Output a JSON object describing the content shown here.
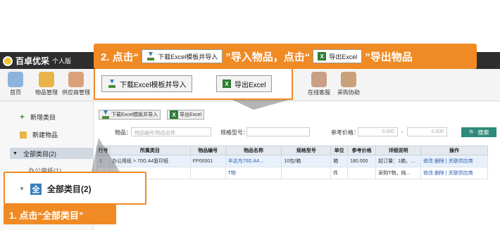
{
  "app": {
    "logo": "百卓优采",
    "edition": "个人版"
  },
  "toolbar": {
    "items": [
      {
        "label": "首页",
        "icon": "home-icon"
      },
      {
        "label": "物品管理",
        "icon": "box-icon"
      },
      {
        "label": "供应商管理",
        "icon": "supplier-icon"
      },
      {
        "label": "在线客服",
        "icon": "service-icon"
      },
      {
        "label": "采购协助",
        "icon": "assist-icon"
      }
    ]
  },
  "sidebar": {
    "add_category": "新增类目",
    "new_item": "新建物品",
    "all_categories": "全部类目(2)",
    "sub_category": "办公用纸(1)"
  },
  "main": {
    "download_template": "下载Excel模板并导入",
    "export_excel": "导出Excel",
    "filter": {
      "item_label": "物品：",
      "item_placeholder": "物品编号/物品名称",
      "spec_label": "规格型号：",
      "price_label": "参考价格：",
      "price_min": "0.000",
      "price_max": "0.000",
      "search_button": "搜索"
    },
    "table": {
      "headers": [
        "行号",
        "所属类目",
        "物品编号",
        "物品名称",
        "规格型号",
        "单位",
        "参考价格",
        "详细说明",
        "操作"
      ],
      "rows": [
        [
          "1",
          "办公用纸 > 70G A4复印纸",
          "FP00001",
          "丰达鸟70G A4…",
          "10包/箱",
          "箱",
          "180.000",
          "起订量：1箱，…",
          "修改 删除 | 关联供应商"
        ],
        [
          "",
          "",
          "",
          "T物",
          "",
          "件",
          "",
          "采购T物，纯…",
          "修改 删除 | 关联供应商"
        ]
      ]
    }
  },
  "callouts": {
    "step2_prefix": "2. 点击“",
    "step2_mid": "”导入物品，点击“",
    "step2_suffix": "”导出物品",
    "step2_chip1": "下载Excel模板并导入",
    "step2_chip2": "导出Excel",
    "zoom_btn1": "下载Excel模板并导入",
    "zoom_btn2": "导出Excel",
    "zoom_category": "全部类目(2)",
    "step1": "1. 点击“全部类目”"
  },
  "colors": {
    "accent": "#f08a24",
    "header_dark": "#2e2e2e",
    "search": "#2e8a7a"
  }
}
